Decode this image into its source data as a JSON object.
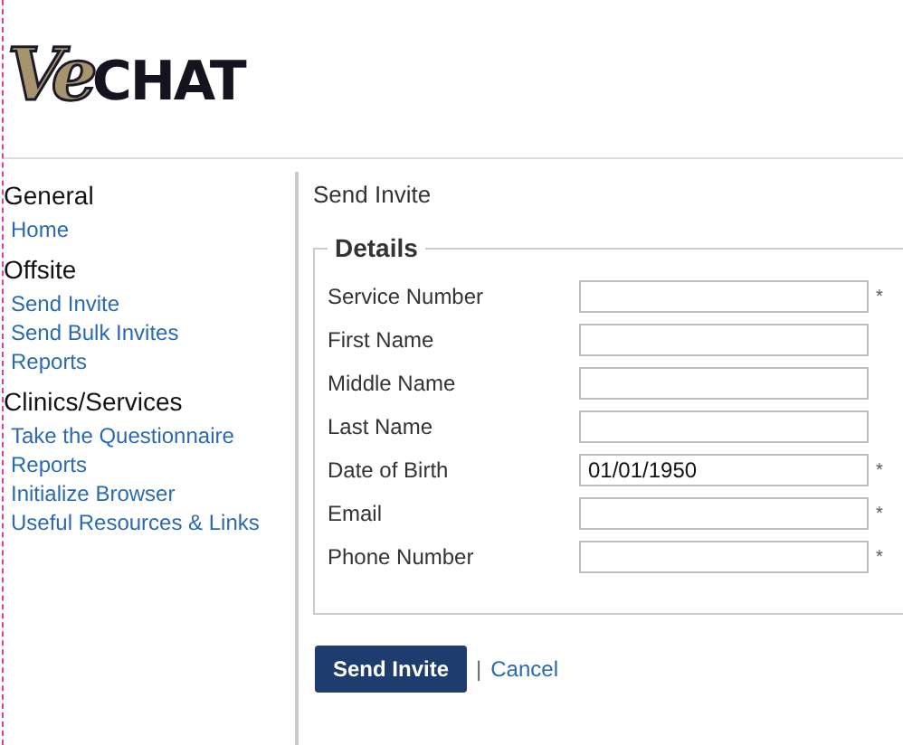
{
  "logo": {
    "script": "Ve",
    "text": "CHAT"
  },
  "sidebar": {
    "sections": [
      {
        "heading": "General",
        "links": [
          "Home"
        ]
      },
      {
        "heading": "Offsite",
        "links": [
          "Send Invite",
          "Send Bulk Invites",
          "Reports"
        ]
      },
      {
        "heading": "Clinics/Services",
        "links": [
          "Take the Questionnaire",
          "Reports",
          "Initialize Browser",
          "Useful Resources & Links"
        ]
      }
    ]
  },
  "page_title": "Send Invite",
  "form": {
    "legend": "Details",
    "fields": [
      {
        "label": "Service Number",
        "required_mark": "*"
      },
      {
        "label": "First Name"
      },
      {
        "label": "Middle Name"
      },
      {
        "label": "Last Name"
      },
      {
        "label": "Date of Birth",
        "value": "01/01/1950",
        "required_mark": "*"
      },
      {
        "label": "Email",
        "required_mark": "*"
      },
      {
        "label": "Phone Number",
        "required_mark": "*"
      }
    ]
  },
  "actions": {
    "submit": "Send Invite",
    "separator": "|",
    "cancel": "Cancel"
  }
}
